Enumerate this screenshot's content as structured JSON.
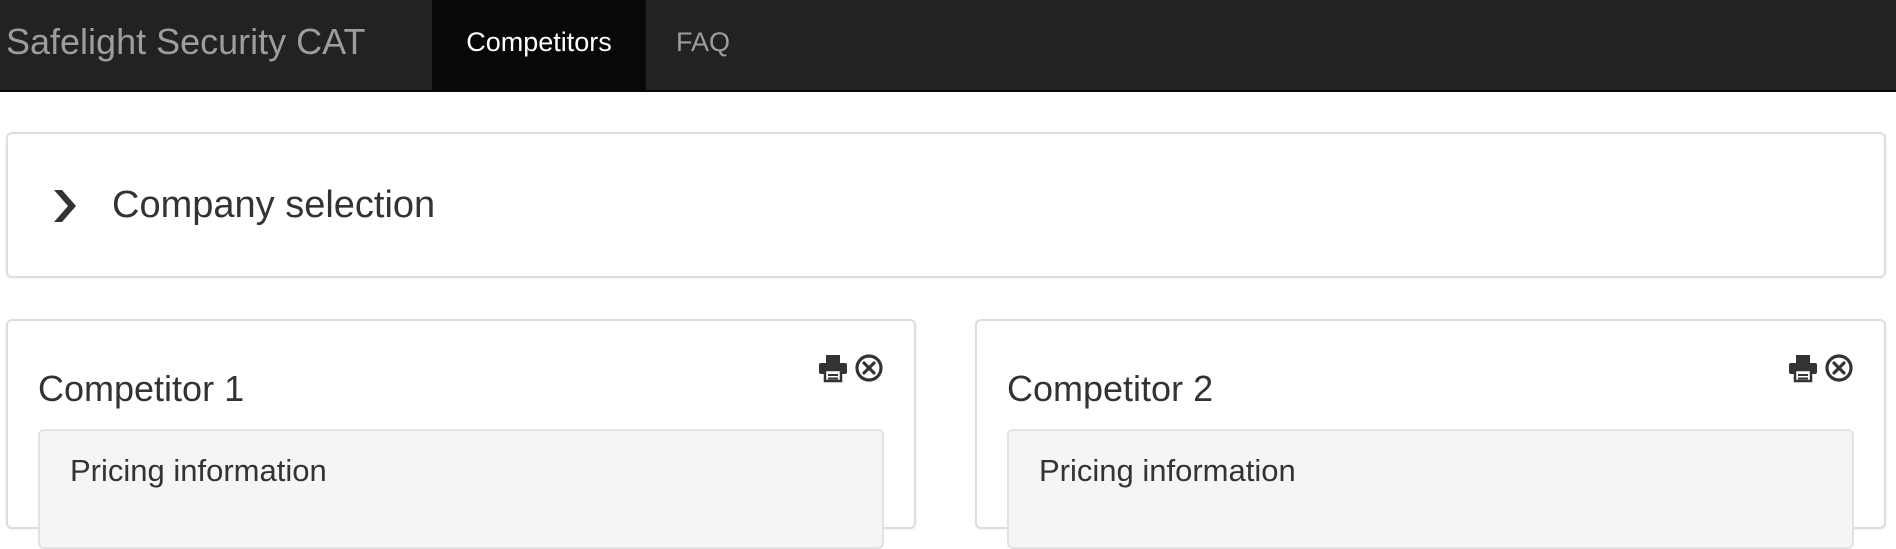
{
  "navbar": {
    "brand": "Safelight Security CAT",
    "items": [
      {
        "label": "Competitors",
        "active": true
      },
      {
        "label": "FAQ",
        "active": false
      }
    ],
    "background": "#222222",
    "active_background": "#080808"
  },
  "company_selection": {
    "title": "Company selection",
    "icon": "chevron-right-icon",
    "collapsed": true
  },
  "competitors": [
    {
      "title": "Competitor 1",
      "actions": [
        "print-icon",
        "close-circle-icon"
      ],
      "sections": [
        {
          "title": "Pricing information"
        }
      ]
    },
    {
      "title": "Competitor 2",
      "actions": [
        "print-icon",
        "close-circle-icon"
      ],
      "sections": [
        {
          "title": "Pricing information"
        }
      ]
    }
  ]
}
